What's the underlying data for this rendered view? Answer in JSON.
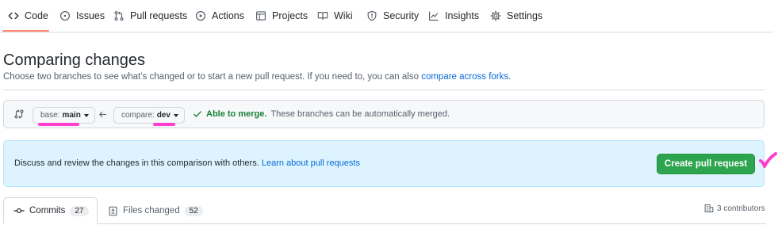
{
  "repo_nav": {
    "tabs": [
      {
        "label": "Code",
        "icon": "code-icon",
        "active": true
      },
      {
        "label": "Issues",
        "icon": "issue-icon"
      },
      {
        "label": "Pull requests",
        "icon": "pull-request-icon"
      },
      {
        "label": "Actions",
        "icon": "play-icon"
      },
      {
        "label": "Projects",
        "icon": "table-icon"
      },
      {
        "label": "Wiki",
        "icon": "book-icon"
      },
      {
        "label": "Security",
        "icon": "shield-icon"
      },
      {
        "label": "Insights",
        "icon": "graph-icon"
      },
      {
        "label": "Settings",
        "icon": "gear-icon"
      }
    ]
  },
  "page": {
    "title": "Comparing changes",
    "subtitle": "Choose two branches to see what’s changed or to start a new pull request. If you need to, you can also ",
    "subtitle_link": "compare across forks",
    "subtitle_end": "."
  },
  "range": {
    "base_label": "base:",
    "base_branch": "main",
    "compare_label": "compare:",
    "compare_branch": "dev",
    "merge_status": "Able to merge.",
    "merge_detail": "These branches can be automatically merged."
  },
  "flash": {
    "text": "Discuss and review the changes in this comparison with others. ",
    "link": "Learn about pull requests",
    "button": "Create pull request"
  },
  "tabs": {
    "commits_label": "Commits",
    "commits_count": "27",
    "files_label": "Files changed",
    "files_count": "52",
    "contributors": "3 contributors"
  },
  "colors": {
    "accent_underline": "#fd8c73",
    "primary_button": "#2da44e",
    "flash_bg": "#ddf4ff",
    "annotation_pink": "#ff3fd0",
    "merge_ok": "#1a7f37"
  }
}
